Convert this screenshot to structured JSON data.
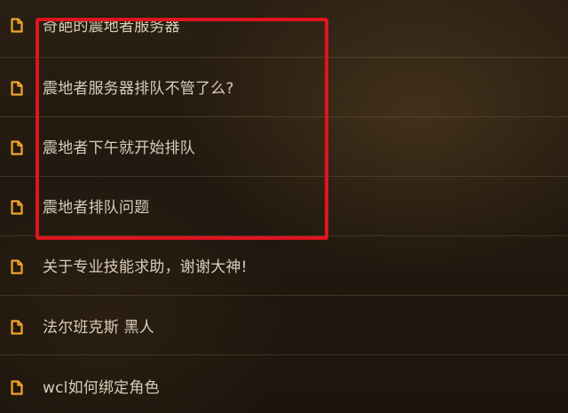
{
  "threads": [
    {
      "title": "奇葩的震地者服务器",
      "icon": "document-icon"
    },
    {
      "title": "震地者服务器排队不管了么?",
      "icon": "document-icon"
    },
    {
      "title": "震地者下午就开始排队",
      "icon": "document-icon"
    },
    {
      "title": "震地者排队问题",
      "icon": "document-icon"
    },
    {
      "title": "关于专业技能求助，谢谢大神!",
      "icon": "document-icon"
    },
    {
      "title": "法尔班克斯 黑人",
      "icon": "document-icon"
    },
    {
      "title": "wcl如何绑定角色",
      "icon": "document-icon"
    }
  ],
  "colors": {
    "icon": "#f0a52c",
    "text": "#d8cdb8",
    "highlight": "#e0141e",
    "background": "#24190f"
  }
}
